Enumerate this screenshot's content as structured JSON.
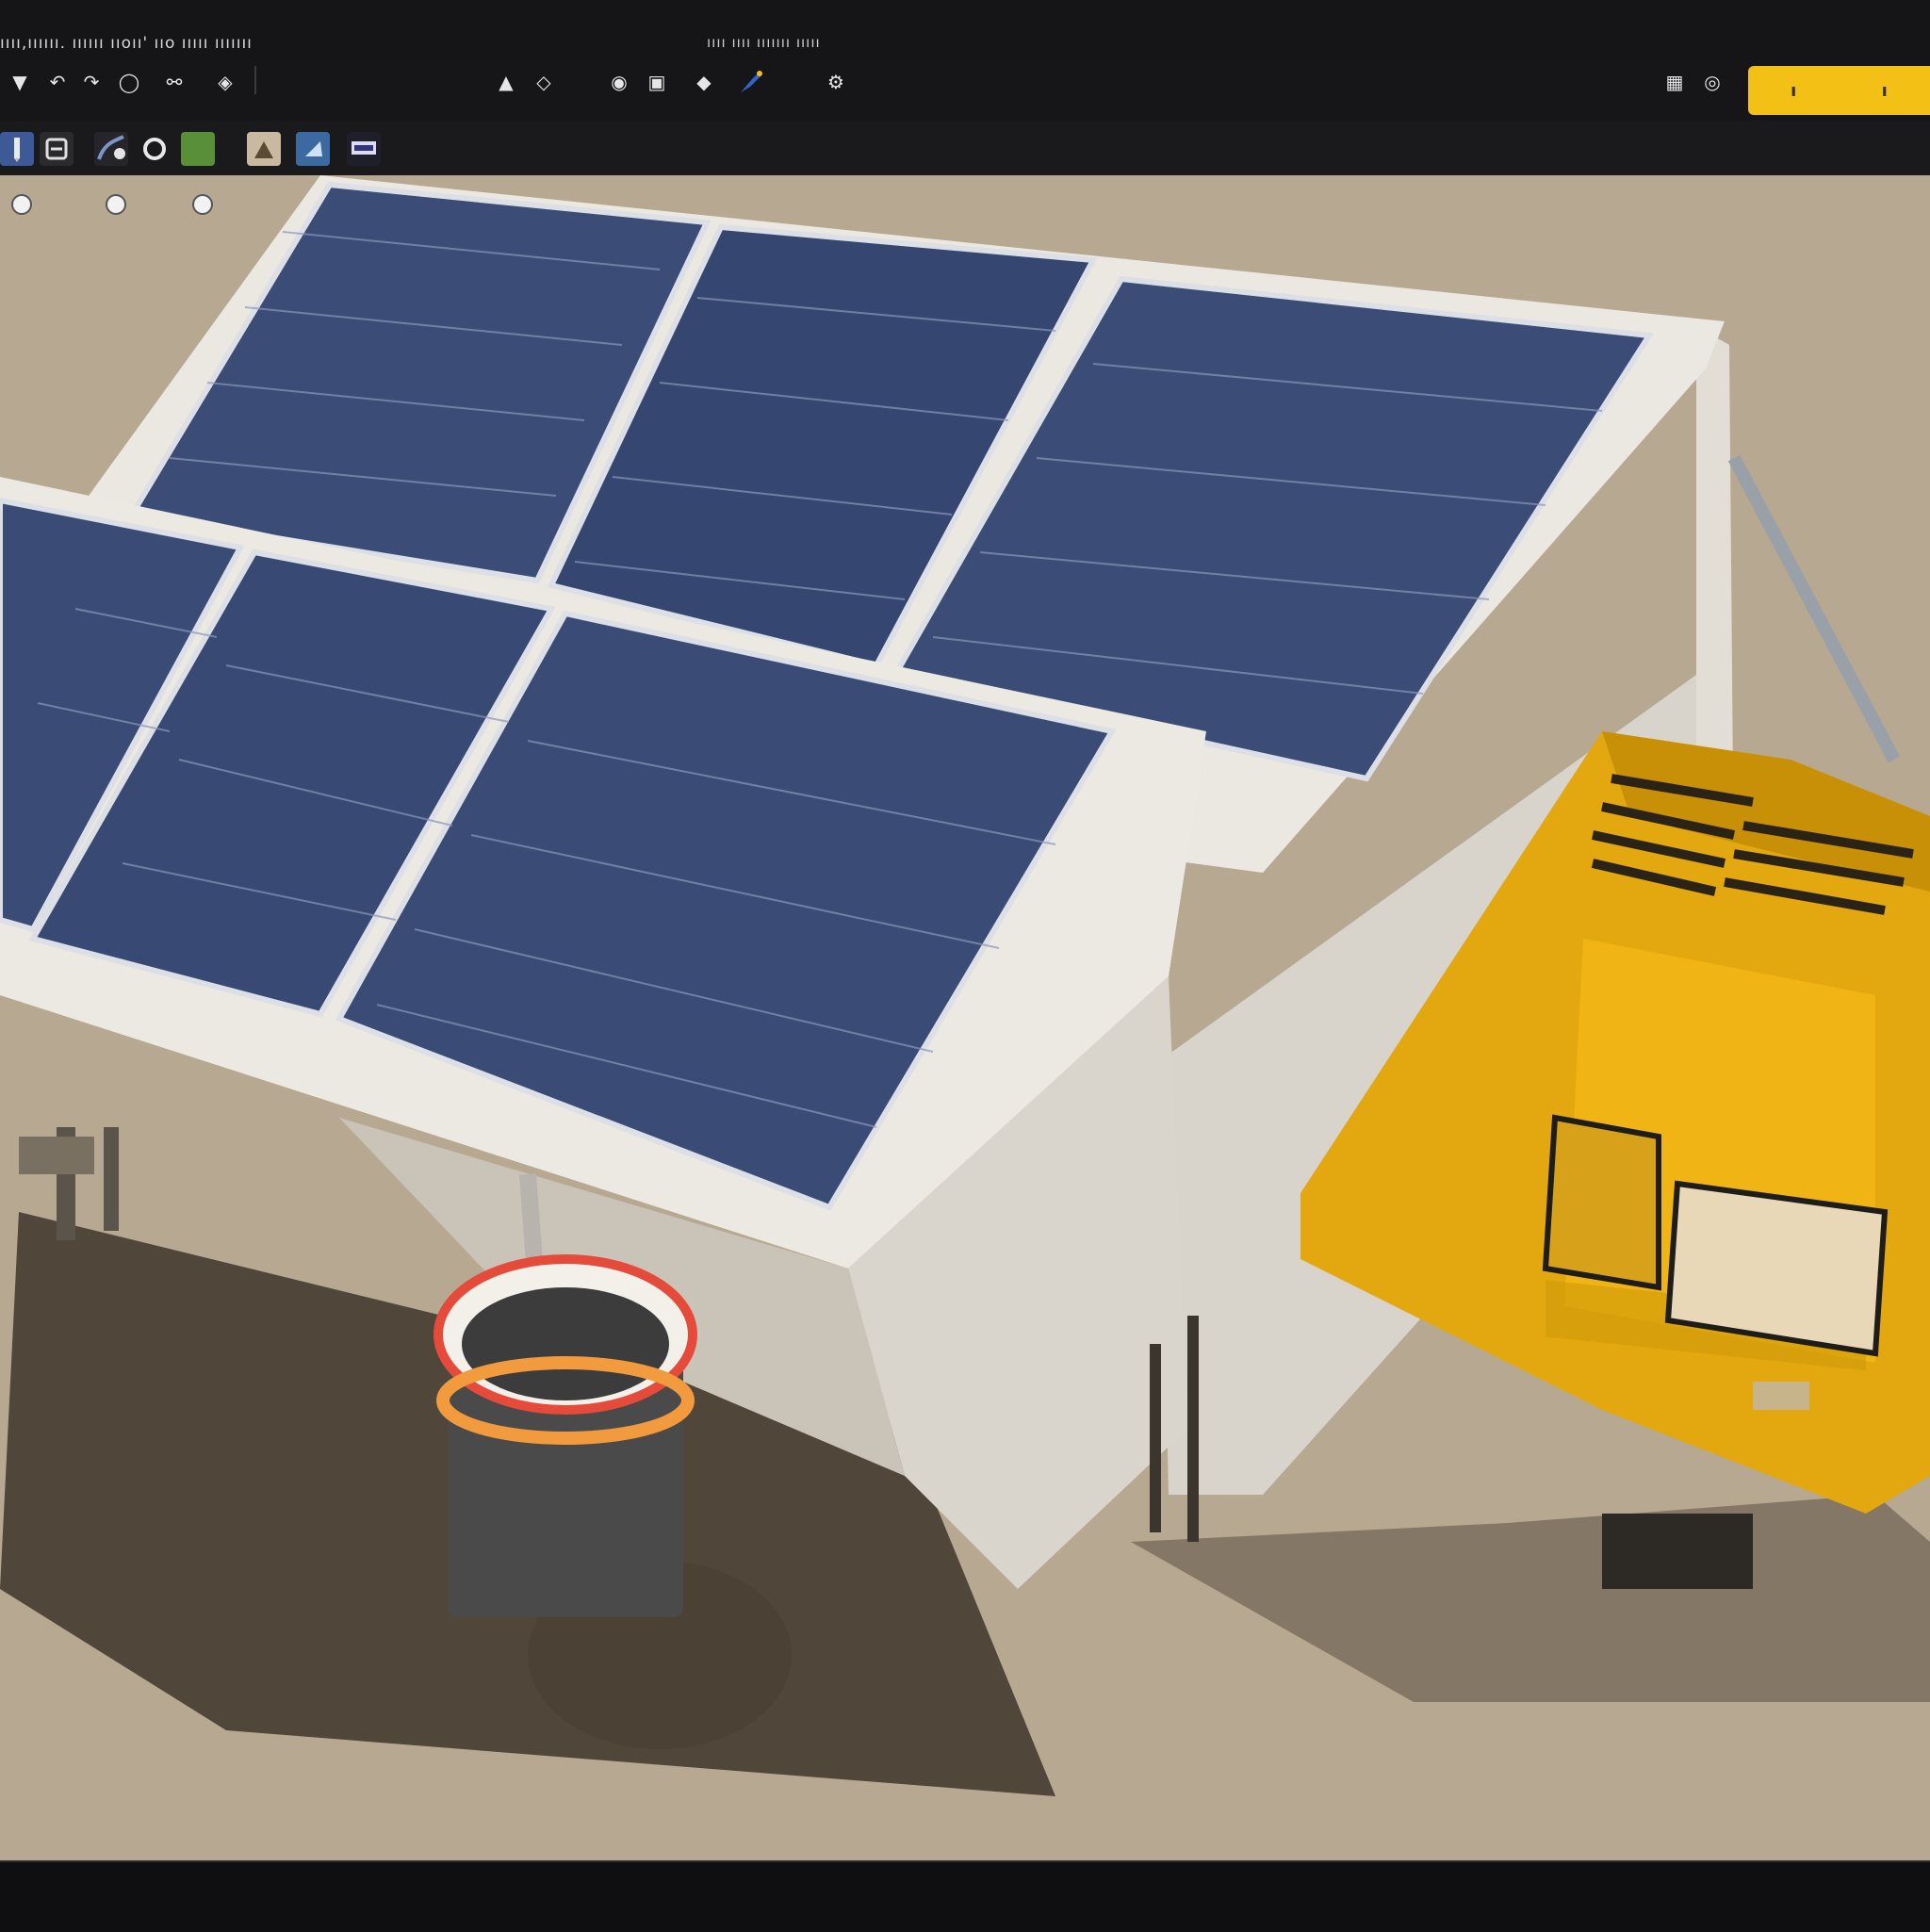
{
  "window": {
    "title": "ıııı,ıııııı. ıııııı ııoıı' ııo ııııı ııııııı",
    "subtitle": "ıııı ıııı ııııııı ııııı"
  },
  "toolbar": {
    "search_glyphs": [
      "ı",
      "ı"
    ],
    "icons": [
      "pointer-icon",
      "undo-icon",
      "redo-icon",
      "view-icon",
      "orbit-icon",
      "move-icon",
      "light-icon",
      "shield-icon",
      "paint-icon",
      "ring-icon",
      "folder-icon",
      "help-icon"
    ]
  },
  "tools": [
    "pencil-tool",
    "material-tool",
    "sculpt-tool",
    "ring-tool",
    "landscape-tool",
    "camera-tool",
    "object-tool",
    "panel-tool"
  ],
  "viewport": {
    "scene": "solar-array-with-generator"
  },
  "statusbar": {
    "text": ""
  },
  "colors": {
    "accent": "#f3c116",
    "background": "#121113",
    "ground": "#b7a991",
    "panel_blue": "#3a4b73"
  }
}
